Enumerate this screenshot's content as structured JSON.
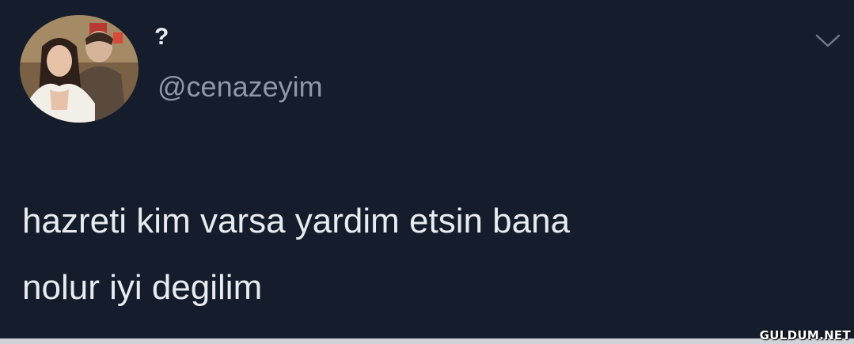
{
  "tweet": {
    "display_name": "?",
    "handle": "@cenazeyim",
    "lines": [
      "hazreti kim varsa yardim etsin bana",
      "nolur iyi degilim"
    ]
  },
  "icons": {
    "avatar": "profile-photo",
    "menu": "chevron-down-icon"
  },
  "watermark": "GULDUM.NET",
  "colors": {
    "background": "#151c2b",
    "text": "#e8ebef",
    "handle": "#8e99a5",
    "chevron": "#6f7a87"
  }
}
